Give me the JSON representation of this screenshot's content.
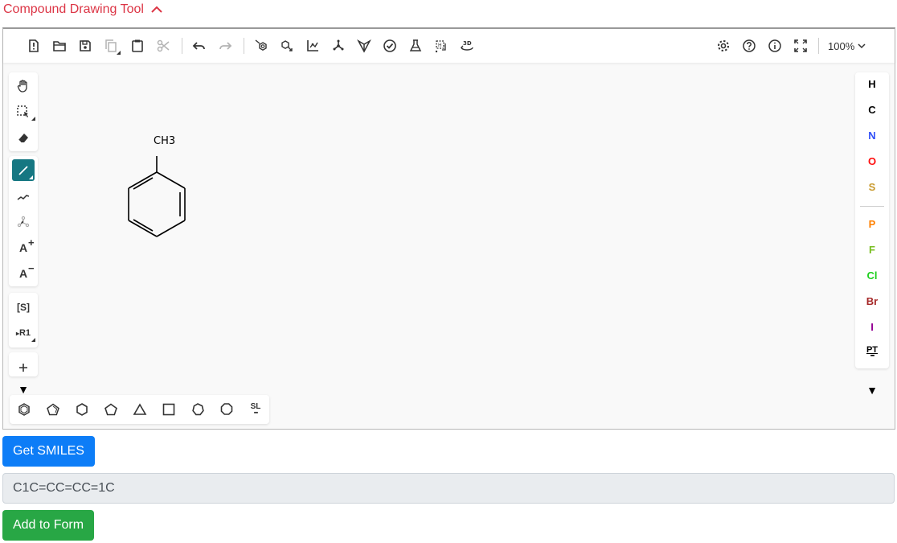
{
  "section": {
    "title": "Compound Drawing Tool",
    "toggle_icon": "chevron-up-icon",
    "color": "#dc3545"
  },
  "toolbar": {
    "left_icons": [
      "new-document-icon",
      "open-folder-icon",
      "save-icon",
      "copy-icon",
      "paste-icon",
      "cut-icon",
      "undo-icon",
      "redo-icon",
      "aromatize-icon",
      "dearomatize-icon",
      "layout-icon",
      "clean-icon",
      "stereo-icon",
      "check-structure-icon",
      "calculated-values-icon",
      "explicit-hydrogens-icon",
      "3d-view-icon"
    ],
    "right_icons": [
      "settings-icon",
      "help-icon",
      "info-icon",
      "fullscreen-icon"
    ],
    "zoom_label": "100%"
  },
  "left_toolbar": {
    "items": [
      "hand-tool",
      "select-tool",
      "erase-tool",
      "bond-single",
      "chain-tool",
      "stereo-tool",
      "charge-plus",
      "charge-minus",
      "sgroup-tool",
      "rgroup-tool",
      "plus-tool",
      "more"
    ],
    "active": "bond-single",
    "active_color": "#167782",
    "sgroup_label": "[S]",
    "rgroup_label": "R1"
  },
  "templates": {
    "items": [
      "benzene",
      "cyclopentadiene",
      "cyclohexane",
      "cyclopentane",
      "cyclopropane",
      "cyclobutane",
      "cycloheptane",
      "cyclooctane",
      "structure-library"
    ],
    "library_label": "SL"
  },
  "atoms": {
    "items": [
      {
        "symbol": "H",
        "color": "#000000"
      },
      {
        "symbol": "C",
        "color": "#000000"
      },
      {
        "symbol": "N",
        "color": "#304ff7"
      },
      {
        "symbol": "O",
        "color": "#ff0d0d"
      },
      {
        "symbol": "S",
        "color": "#c99a2e"
      },
      {
        "symbol": "P",
        "color": "#ff8000"
      },
      {
        "symbol": "F",
        "color": "#78be21"
      },
      {
        "symbol": "Cl",
        "color": "#1fd01f"
      },
      {
        "symbol": "Br",
        "color": "#a62929"
      },
      {
        "symbol": "I",
        "color": "#940094"
      }
    ],
    "periodic_table_label": "PT"
  },
  "molecule": {
    "substituent_label": "CH3"
  },
  "actions": {
    "get_smiles_label": "Get SMILES",
    "smiles_value": "C1C=CC=CC=1C",
    "add_to_form_label": "Add to Form"
  }
}
